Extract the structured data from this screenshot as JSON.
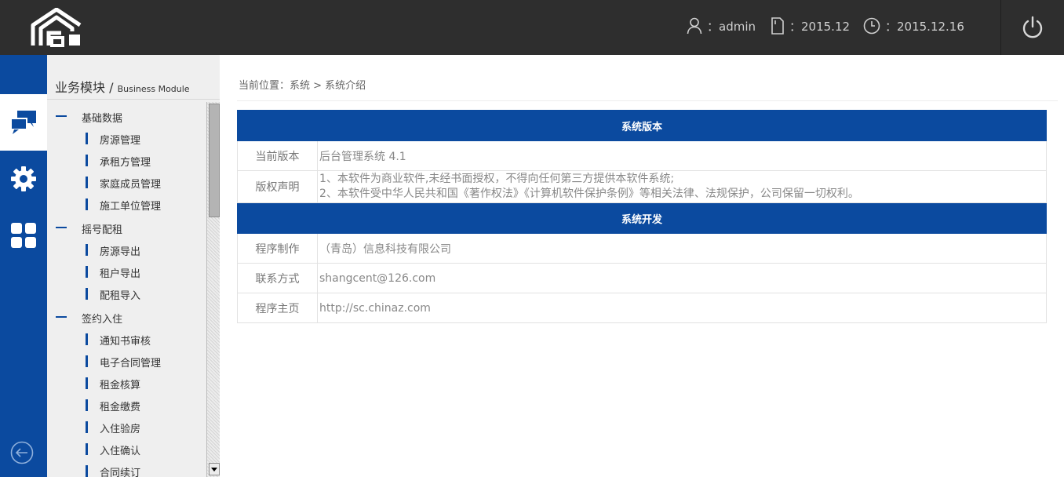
{
  "header": {
    "user_label": "：admin",
    "period_label": "：2015.12",
    "date_label": "：2015.12.16"
  },
  "sidebar": {
    "title": "业务模块 / ",
    "title_en": "Business Module",
    "groups": [
      {
        "label": "基础数据",
        "items": [
          "房源管理",
          "承租方管理",
          "家庭成员管理",
          "施工单位管理"
        ]
      },
      {
        "label": "摇号配租",
        "items": [
          "房源导出",
          "租户导出",
          "配租导入"
        ]
      },
      {
        "label": "签约入住",
        "items": [
          "通知书审核",
          "电子合同管理",
          "租金核算",
          "租金缴费",
          "入住验房",
          "入住确认",
          "合同续订"
        ]
      }
    ]
  },
  "main": {
    "breadcrumb": "当前位置：系统 > 系统介绍",
    "section_version": "系统版本",
    "rows_version": [
      {
        "key": "当前版本",
        "value": "后台管理系统 4.1"
      }
    ],
    "copyright_key": "版权声明",
    "copyright_lines": [
      "1、本软件为商业软件,未经书面授权，不得向任何第三方提供本软件系统;",
      "2、本软件受中华人民共和国《著作权法》《计算机软件保护条例》等相关法律、法规保护，公司保留一切权利。"
    ],
    "section_dev": "系统开发",
    "rows_dev": [
      {
        "key": "程序制作",
        "value": "（青岛）信息科技有限公司"
      },
      {
        "key": "联系方式",
        "value": "shangcent@126.com"
      },
      {
        "key": "程序主页",
        "value": "http://sc.chinaz.com"
      }
    ]
  },
  "colors": {
    "topbar": "#2e2e2e",
    "brand_blue": "#0b4a9f",
    "sidebar_bg": "#efefef"
  }
}
